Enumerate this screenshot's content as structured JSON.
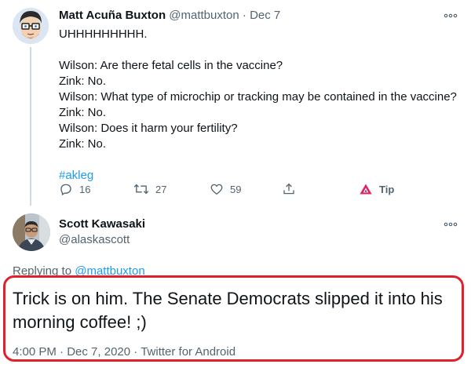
{
  "parent_tweet": {
    "author_name": "Matt Acuña Buxton",
    "handle": "@mattbuxton",
    "separator": "·",
    "date": "Dec 7",
    "lines": [
      "UHHHHHHHHH.",
      "",
      "Wilson: Are there fetal cells in the vaccine?",
      "Zink: No.",
      "Wilson: What type of microchip or tracking may be contained in the vaccine?",
      "Zink: No.",
      "Wilson: Does it harm your fertility?",
      "Zink: No.",
      "",
      "#akleg"
    ],
    "actions": {
      "reply_count": "16",
      "retweet_count": "27",
      "like_count": "59",
      "tip_label": "Tip"
    },
    "icons": {
      "reply": "reply-icon",
      "retweet": "retweet-icon",
      "like": "heart-icon",
      "share": "share-icon",
      "tip": "tip-icon",
      "more": "more-icon"
    }
  },
  "reply_tweet": {
    "author_name": "Scott Kawasaki",
    "handle": "@alaskascott",
    "replying_prefix": "Replying to",
    "replying_to": "@mattbuxton",
    "text": "Trick is on him. The Senate Democrats slipped it into his morning coffee! ;)",
    "time": "4:00 PM",
    "date": "Dec 7, 2020",
    "source": "Twitter for Android",
    "separator": "·"
  },
  "colors": {
    "accent": "#1d9bf0",
    "muted": "#536471",
    "highlight": "#e0212c",
    "tip_red": "#e0245e"
  }
}
